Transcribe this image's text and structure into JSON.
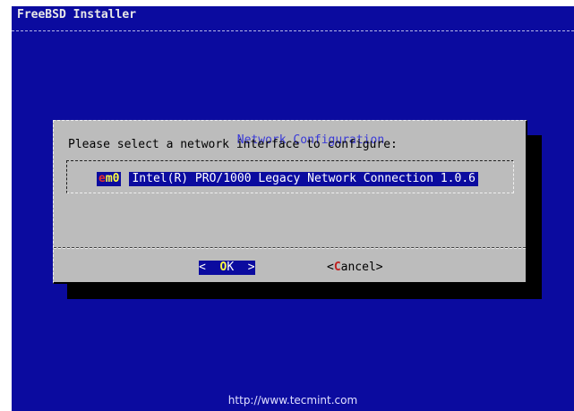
{
  "screen": {
    "title": "FreeBSD Installer"
  },
  "dialog": {
    "title": "Network Configuration",
    "prompt": "Please select a network interface to configure:",
    "menu": {
      "items": [
        {
          "tag_first": "e",
          "tag_rest": "m0",
          "description": "Intel(R) PRO/1000 Legacy Network Connection 1.0.6",
          "selected": true
        }
      ]
    },
    "buttons": {
      "ok": {
        "left": "<",
        "hot": "O",
        "rest": "K",
        "right": ">",
        "selected": true
      },
      "cancel": {
        "left": "<",
        "hot": "C",
        "rest": "ancel",
        "right": ">",
        "selected": false
      }
    }
  },
  "watermark": "http://www.tecmint.com",
  "colors": {
    "background": "#0b0b9f",
    "dialog": "#bcbcbc",
    "title_accent": "#3a3ad8",
    "hotkey_yellow": "#ffff40",
    "hotkey_red": "#e03030"
  }
}
